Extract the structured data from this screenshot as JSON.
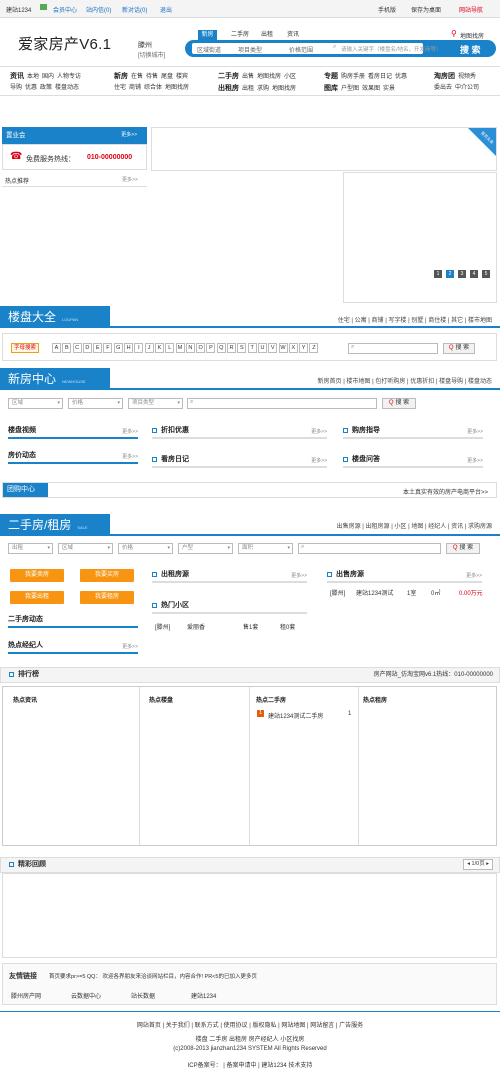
{
  "topbar": {
    "site": "建站1234",
    "member": "会员中心",
    "msg": "站内信(0)",
    "newmsg": "新对话(0)",
    "logout": "退出",
    "mobile": "手机版",
    "save_desktop": "保存为桌面",
    "site_nav": "网站导航"
  },
  "header": {
    "logo": "爱家房产V6.1",
    "city": "滕州",
    "switch_city": "[切换城市]",
    "search_tabs": [
      "新房",
      "二手房",
      "出租",
      "资讯"
    ],
    "map_link": "地图找房",
    "region_select": "区域街道",
    "type_select": "项目类型",
    "price_select": "价格范围",
    "search_placeholder": "请输入关键字（楼盘名/地名，开发商等）",
    "search_button": "搜 索"
  },
  "nav": [
    {
      "title": "资讯",
      "row1": [
        "本地",
        "国内",
        "人物专访"
      ],
      "row2": [
        "导购",
        "优惠",
        "政策",
        "楼盘动态"
      ]
    },
    {
      "title": "新房",
      "row1": [
        "在售",
        "待售",
        "尾盘",
        "楼宾"
      ],
      "row2": [
        "住宅",
        "商铺",
        "综合体",
        "地图找房"
      ]
    },
    {
      "title": "二手房",
      "row1": [
        "出售",
        "地图找房",
        "小区"
      ],
      "title2": "出租房",
      "row2": [
        "出租",
        "求购",
        "地图找房"
      ]
    },
    {
      "title": "专题",
      "row1": [
        "购房手册",
        "看房日记",
        "优惠"
      ],
      "title2": "图库",
      "row2": [
        "户型图",
        "效果图",
        "实景"
      ]
    },
    {
      "title": "淘房团",
      "row1": [
        "视频秀"
      ],
      "row2": [
        "委出去",
        "中介公司"
      ]
    }
  ],
  "left": {
    "open_house": "置业会",
    "more": "更多>>",
    "hotline_label": "免费服务热线：",
    "hotline": "010-00000000",
    "hot_rec": "热点推荐",
    "hot_more": "更多>>",
    "banner_corner": "首页头条"
  },
  "pager": [
    "1",
    "2",
    "3",
    "4",
    "5"
  ],
  "loupan": {
    "title": "楼盘大全",
    "en": "LOUPAN",
    "links": "住宅 | 公寓 | 商铺 | 写字楼 | 别墅 | 商住楼 | 其它 | 楼市地图",
    "letter_search": "字母搜索",
    "letters": [
      "A",
      "B",
      "C",
      "D",
      "E",
      "F",
      "G",
      "H",
      "I",
      "J",
      "K",
      "L",
      "M",
      "N",
      "O",
      "P",
      "Q",
      "R",
      "S",
      "T",
      "U",
      "V",
      "W",
      "X",
      "Y",
      "Z"
    ],
    "search_btn": "搜 索"
  },
  "newhouse": {
    "title": "新房中心",
    "en": "NEWHOUSE",
    "links": "新房首页 | 楼市地图 | 包打听购房 | 优惠折扣 | 楼盘导购 | 楼盘动态",
    "sel_region": "区域",
    "sel_price": "价格",
    "sel_type": "项目类型",
    "search_btn": "搜 索",
    "boxes": [
      {
        "title": "楼盘视频",
        "more": "更多>>"
      },
      {
        "title": "折扣优惠",
        "more": "更多>>"
      },
      {
        "title": "购房指导",
        "more": "更多>>"
      },
      {
        "title": "房价动态",
        "more": "更多>>"
      },
      {
        "title": "看房日记",
        "more": "更多>>"
      },
      {
        "title": "楼盘问答",
        "more": "更多>>"
      }
    ]
  },
  "group": {
    "title": "团购中心",
    "right": "本土真实有效的房产电商平台>>"
  },
  "esf": {
    "title": "二手房/租房",
    "en": "SALE",
    "links": "出售房源 | 出租房源 | 小区 | 地图 | 经纪人 | 资讯 | 求购房源",
    "sels": [
      "出租",
      "区域",
      "价格",
      "户型",
      "面积"
    ],
    "search_btn": "搜 索",
    "btns": [
      "我要卖房",
      "我要买房",
      "我要出租",
      "我要租房"
    ],
    "rent_title": "出租房源",
    "sale_title": "出售房源",
    "hot_xq": "热门小区",
    "esf_dyn": "二手房动态",
    "hot_agent": "热点经纪人",
    "more": "更多>>",
    "sale_row": [
      "[滕州]",
      "建站1234测试",
      "1室",
      "0㎡",
      "0.00万元"
    ],
    "xq_row": [
      "[滕州]",
      "爱丽香",
      "售1套",
      "租0套"
    ]
  },
  "rank": {
    "title": "排行榜",
    "right": "房产网站_仿淘宝网v6.1热线：010-00000000",
    "cols": [
      "热点资讯",
      "热点楼盘",
      "热点二手房",
      "热点租房"
    ],
    "esf_item": "建站1234测试二手房",
    "esf_num": "1",
    "esf_rank": "1"
  },
  "review": {
    "title": "精彩回顾",
    "page": "1/0页"
  },
  "friend": {
    "title": "友情链接",
    "note": "首页要求pr>=5 QQ：  欢迎各界朋友来洽谈网站栏目，内容合作! PR<5的已加入更多页",
    "links": [
      "滕州房产网",
      "云数据中心",
      "站长数据",
      "建站1234"
    ]
  },
  "footer": {
    "line1": "网站首页 | 关于我们 | 联系方式 | 使用协议 | 版权隐私 | 网站地图 | 网站留言 | 广告服务",
    "line2": "楼盘    二手房    出租房    房产经纪人    小区找房",
    "line3": "(c)2008-2013 jianzhan1234 SYSTEM All Rights Reserved",
    "line4": "ICP备案号：  | 备案申请中 | 建站1234 技术支持"
  }
}
